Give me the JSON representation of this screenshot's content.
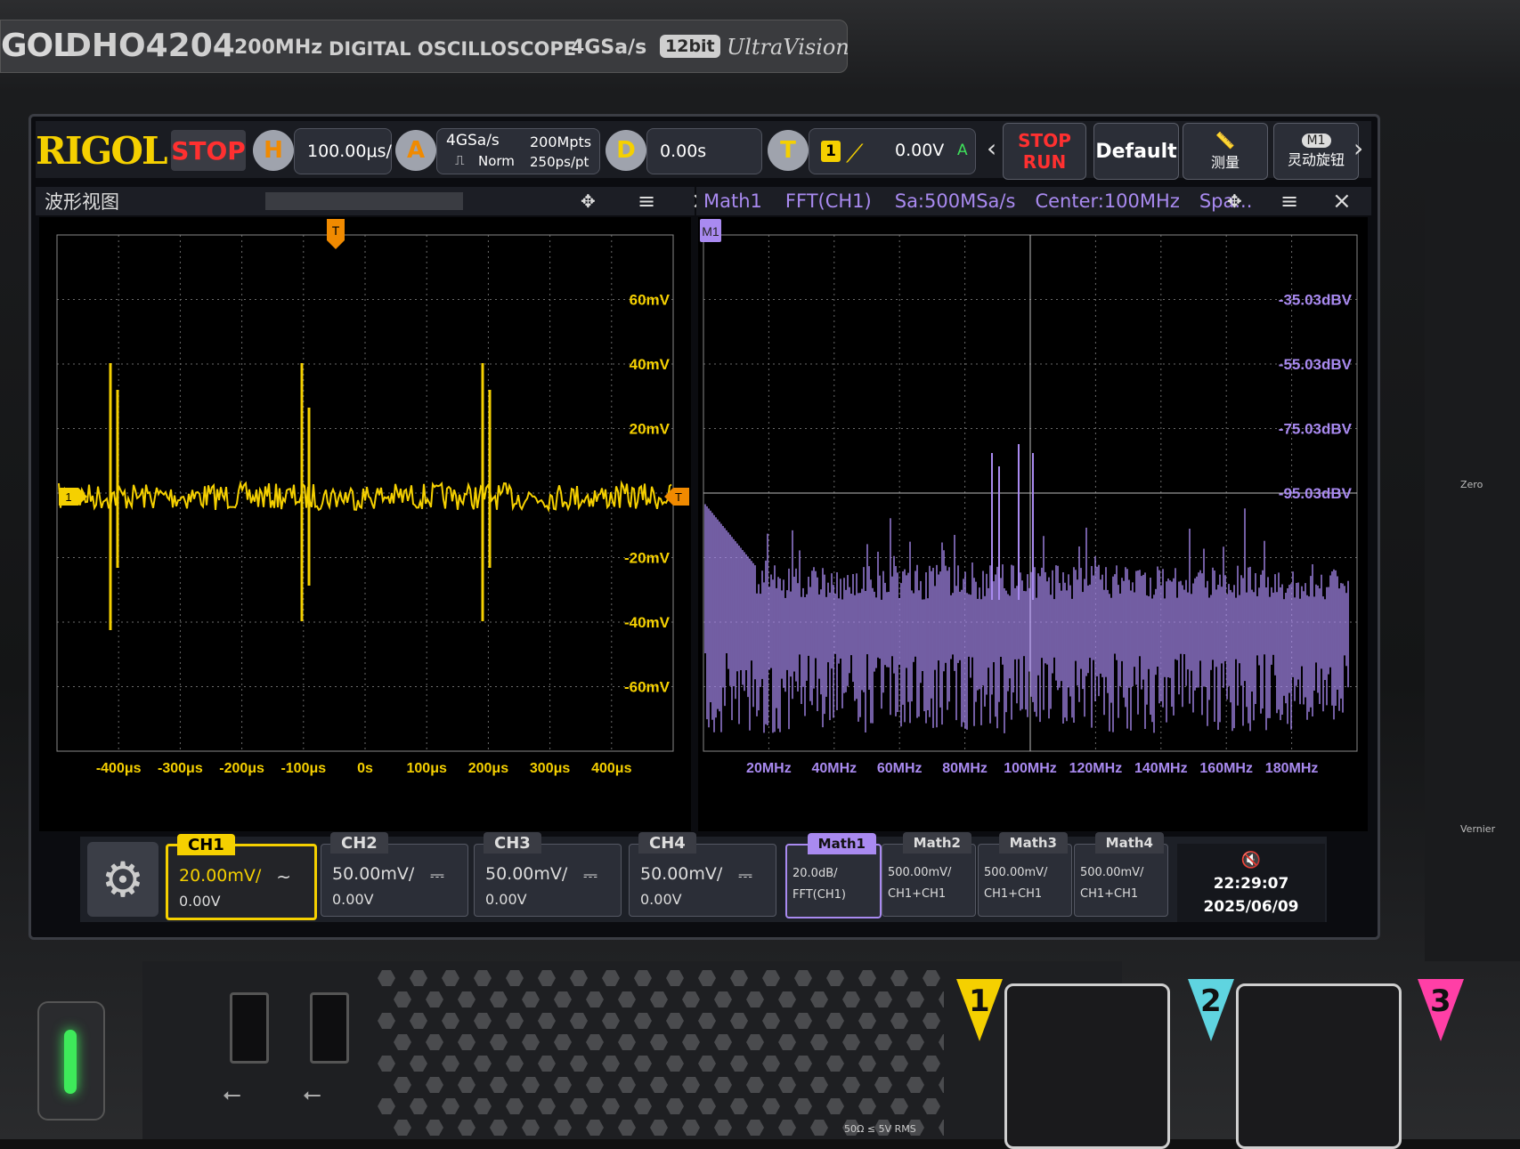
{
  "brand": {
    "logo": "GOL",
    "model": "DHO4204",
    "bandwidth": "200MHz",
    "description": "DIGITAL OSCILLOSCOPE",
    "sample_rate": "4GSa/s",
    "bits": "12bit",
    "ultravision": "UltraVision"
  },
  "toolbar": {
    "logo": "RIGOL",
    "run_state": "STOP",
    "horizontal": {
      "key": "H",
      "value": "100.00μs/"
    },
    "acquire": {
      "key": "A",
      "rate": "4GSa/s",
      "mode": "Norm",
      "depth": "200Mpts",
      "resolution": "250ps/pt"
    },
    "delay": {
      "key": "D",
      "value": "0.00s"
    },
    "trigger": {
      "key": "T",
      "source": "1",
      "level": "0.00V",
      "mode": "A"
    },
    "stop_run_label_1": "STOP",
    "stop_run_label_2": "RUN",
    "default_label": "Default",
    "measure_label": "测量",
    "knob_label": "灵动旋钮",
    "knob_badge": "M1"
  },
  "left_pane": {
    "title": "波形视图",
    "trigger_marker": "T",
    "ch_marker": "1",
    "y_labels": [
      "60mV",
      "40mV",
      "20mV",
      "-20mV",
      "-40mV",
      "-60mV"
    ],
    "x_labels": [
      "-400μs",
      "-300μs",
      "-200μs",
      "-100μs",
      "0s",
      "100μs",
      "200μs",
      "300μs",
      "400μs"
    ]
  },
  "right_pane": {
    "tabs": [
      "Math1",
      "FFT(CH1)",
      "Sa:500MSa/s",
      "Center:100MHz",
      "Spa..."
    ],
    "marker": "M1",
    "y_labels": [
      "-35.03dBV",
      "-55.03dBV",
      "-75.03dBV",
      "-95.03dBV"
    ],
    "x_labels": [
      "20MHz",
      "40MHz",
      "60MHz",
      "80MHz",
      "100MHz",
      "120MHz",
      "140MHz",
      "160MHz",
      "180MHz"
    ]
  },
  "channels": [
    {
      "name": "CH1",
      "scale": "20.00mV/",
      "offset": "0.00V",
      "coupling": "~",
      "active": true
    },
    {
      "name": "CH2",
      "scale": "50.00mV/",
      "offset": "0.00V",
      "coupling": "⎓",
      "active": false
    },
    {
      "name": "CH3",
      "scale": "50.00mV/",
      "offset": "0.00V",
      "coupling": "⎓",
      "active": false
    },
    {
      "name": "CH4",
      "scale": "50.00mV/",
      "offset": "0.00V",
      "coupling": "⎓",
      "active": false
    }
  ],
  "maths": [
    {
      "name": "Math1",
      "line1": "20.0dB/",
      "line2": "FFT(CH1)",
      "active": true
    },
    {
      "name": "Math2",
      "line1": "500.00mV/",
      "line2": "CH1+CH1",
      "active": false
    },
    {
      "name": "Math3",
      "line1": "500.00mV/",
      "line2": "CH1+CH1",
      "active": false
    },
    {
      "name": "Math4",
      "line1": "500.00mV/",
      "line2": "CH1+CH1",
      "active": false
    }
  ],
  "status": {
    "time": "22:29:07",
    "date": "2025/06/09",
    "mute_icon": "speaker-mute-icon"
  },
  "front_panel": {
    "inputs": [
      "1",
      "2",
      "3"
    ],
    "input_rating": "50Ω ≤ 5V RMS",
    "side_labels": [
      "Zero",
      "Vernier"
    ]
  },
  "colors": {
    "ch1": "#f5d000",
    "math1": "#a98af0",
    "stop": "#ff3030",
    "ch2": "#5fd4e0",
    "ch3": "#ff3fa6"
  }
}
